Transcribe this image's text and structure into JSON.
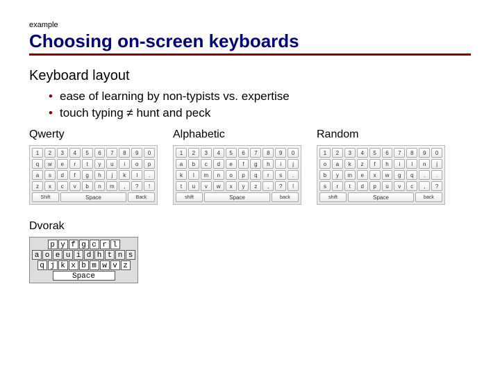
{
  "tag": "example",
  "title": "Choosing on-screen keyboards",
  "subhead": "Keyboard layout",
  "bullets": [
    "ease of learning by non-typists vs. expertise",
    "touch typing ≠ hunt and peck"
  ],
  "layouts": {
    "qwerty": {
      "label": "Qwerty",
      "rows": [
        [
          "1",
          "2",
          "3",
          "4",
          "5",
          "6",
          "7",
          "8",
          "9",
          "0"
        ],
        [
          "q",
          "w",
          "e",
          "r",
          "t",
          "y",
          "u",
          "i",
          "o",
          "p"
        ],
        [
          "a",
          "s",
          "d",
          "f",
          "g",
          "h",
          "j",
          "k",
          "l",
          "."
        ],
        [
          "z",
          "x",
          "c",
          "v",
          "b",
          "n",
          "m",
          ",",
          "?",
          "!"
        ]
      ],
      "bottom": {
        "shift": "Shift",
        "space": "Space",
        "back": "Back"
      }
    },
    "alphabetic": {
      "label": "Alphabetic",
      "rows": [
        [
          "1",
          "2",
          "3",
          "4",
          "5",
          "6",
          "7",
          "8",
          "9",
          "0"
        ],
        [
          "a",
          "b",
          "c",
          "d",
          "e",
          "f",
          "g",
          "h",
          "i",
          "j"
        ],
        [
          "k",
          "l",
          "m",
          "n",
          "o",
          "p",
          "q",
          "r",
          "s",
          "."
        ],
        [
          "t",
          "u",
          "v",
          "w",
          "x",
          "y",
          "z",
          ",",
          "?",
          "!"
        ]
      ],
      "bottom": {
        "shift": "shift",
        "space": "Space",
        "back": "back"
      }
    },
    "random": {
      "label": "Random",
      "rows": [
        [
          "1",
          "2",
          "3",
          "4",
          "5",
          "6",
          "7",
          "8",
          "9",
          "0"
        ],
        [
          "o",
          "a",
          "k",
          "z",
          "f",
          "h",
          "i",
          "l",
          "n",
          "j"
        ],
        [
          "b",
          "y",
          "m",
          "e",
          "x",
          "w",
          "g",
          "q",
          ".",
          "."
        ],
        [
          "s",
          "r",
          "t",
          "d",
          "p",
          "u",
          "v",
          "c",
          ",",
          "?"
        ]
      ],
      "bottom": {
        "shift": "shift",
        "space": "Space",
        "back": "back"
      }
    },
    "dvorak": {
      "label": "Dvorak",
      "rows": [
        [
          "p",
          "y",
          "f",
          "g",
          "c",
          "r",
          "l"
        ],
        [
          "a",
          "o",
          "e",
          "u",
          "i",
          "d",
          "h",
          "t",
          "n",
          "s"
        ],
        [
          "q",
          "j",
          "k",
          "x",
          "b",
          "m",
          "w",
          "v",
          "z"
        ]
      ],
      "space": "Space"
    }
  }
}
